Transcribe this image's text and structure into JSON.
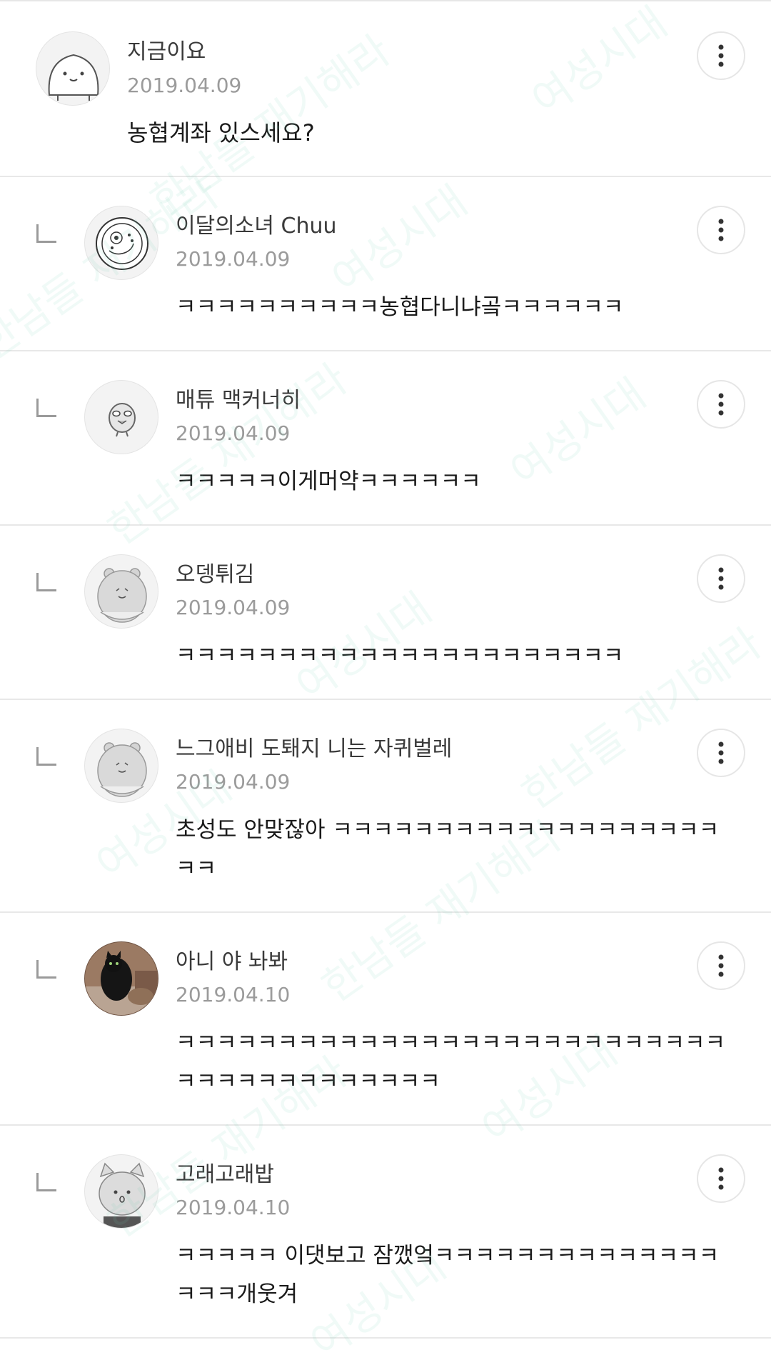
{
  "comments": [
    {
      "author": "지금이요",
      "date": "2019.04.09",
      "text": "농협계좌 있스세요?",
      "avatar": "seal-avatar-icon"
    },
    {
      "author": "이달의소녀 Chuu",
      "date": "2019.04.09",
      "text": "ㅋㅋㅋㅋㅋㅋㅋㅋㅋㅋ농협다니냐곸ㅋㅋㅋㅋㅋㅋ",
      "avatar": "food-plate-avatar-icon"
    },
    {
      "author": "매튜 맥커너히",
      "date": "2019.04.09",
      "text": "ㅋㅋㅋㅋㅋ이게머약ㅋㅋㅋㅋㅋㅋ",
      "avatar": "chick-avatar-icon"
    },
    {
      "author": "오뎅튀김",
      "date": "2019.04.09",
      "text": "ㅋㅋㅋㅋㅋㅋㅋㅋㅋㅋㅋㅋㅋㅋㅋㅋㅋㅋㅋㅋㅋㅋ",
      "avatar": "bear-avatar-icon"
    },
    {
      "author": "느그애비 도퇘지 니는 자퀴벌레",
      "date": "2019.04.09",
      "text": "초성도 안맞잖아 ㅋㅋㅋㅋㅋㅋㅋㅋㅋㅋㅋㅋㅋㅋㅋㅋㅋㅋㅋㅋㅋ",
      "avatar": "bear-avatar-icon"
    },
    {
      "author": "아니 야 놔봐",
      "date": "2019.04.10",
      "text": "ㅋㅋㅋㅋㅋㅋㅋㅋㅋㅋㅋㅋㅋㅋㅋㅋㅋㅋㅋㅋㅋㅋㅋㅋㅋㅋㅋㅋㅋㅋㅋㅋㅋㅋㅋㅋㅋㅋㅋㅋ",
      "avatar": "cat-photo-avatar"
    },
    {
      "author": "고래고래밥",
      "date": "2019.04.10",
      "text": "ㅋㅋㅋㅋㅋ 이댓보고 잠깼엌ㅋㅋㅋㅋㅋㅋㅋㅋㅋㅋㅋㅋㅋㅋㅋㅋㅋ개웃겨",
      "avatar": "cat-avatar-icon"
    }
  ],
  "more_icon": "more-vertical-icon",
  "reply_icon": "reply-arrow-icon",
  "watermark": [
    "여성시대",
    "한남들 재기해라"
  ],
  "colors": {
    "author": "#3a3a3a",
    "date": "#9b9b9b",
    "text": "#1a1a1a",
    "divider": "#e8e8e8",
    "watermark": "#78cdb4"
  }
}
